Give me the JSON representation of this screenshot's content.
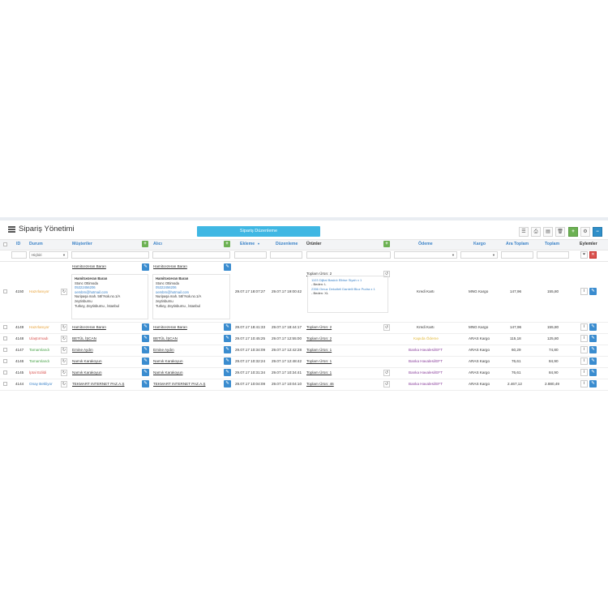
{
  "title": "Sipariş Yönetimi",
  "primary_button": "Sipariş Düzenleme",
  "columns": {
    "id": "ID",
    "status": "Durum",
    "customers": "Müşteriler",
    "buyer": "Alıcı",
    "added": "Ekleme",
    "edited": "Düzenleme",
    "products": "Ürünler",
    "payment": "Ödeme",
    "shipping": "Kargo",
    "subtotal": "Ara Toplam",
    "total": "Toplam",
    "actions": "Eylemler"
  },
  "filters": {
    "status_select": "Hiçbiri"
  },
  "expanded_row": {
    "id": "4150",
    "status": "Hazırlanıyor",
    "customer_link": "Hamitcezeran Baran",
    "customer_card": {
      "name": "Hamitcezeran Baran",
      "line1": "Stonc Ottimoda",
      "phone": "05322456206",
      "email": "oembrn@hotmail.com",
      "addr1": "Nuripaşa mah. 58/?sok.no.1/A",
      "addr2": "zeytinburnu",
      "addr3": "Turkey, Zeytinburnu , İstanbul"
    },
    "buyer_link": "Hamitcezeran Baran",
    "buyer_card": {
      "name": "Hamitcezeran Baran",
      "line1": "Stonc Ottimoda",
      "phone": "05322456206",
      "email": "oembrn@hotmail.com",
      "addr1": "Nuripaşa mah. 58/?sok.no.1/A",
      "addr2": "zeytinburnu",
      "addr3": "Turkey, Zeytinburnu , İstanbul"
    },
    "added": "29.07.17 18:07:27",
    "edited": "29.07.17 19:00:42",
    "products_link": "Toplam Ürün: 2",
    "product_items": [
      {
        "name": "1103 Dijital Baskılı Elbise Siyah x 1",
        "detail": "- Beden: L"
      },
      {
        "name": "2356 Omuz Dekolteli Dantelli Bluz Pudra x 1",
        "detail": "- Beden: XL"
      }
    ],
    "payment": "Kredi Kartı",
    "shipping": "MNG Kargo",
    "subtotal": "147,96",
    "total": "155,80"
  },
  "rows": [
    {
      "id": "4149",
      "status": "Hazırlanıyor",
      "customer": "Hamitcezeran Baran",
      "buyer": "Hamitcezeran Baran",
      "added": "29.07.17 18:41:33",
      "edited": "29.07.17 18:44:17",
      "products": "Toplam Ürün: 2",
      "payment": "Kredi Kartı",
      "shipping": "MNG Kargo",
      "subtotal": "147,96",
      "total": "155,80"
    },
    {
      "id": "4148",
      "status": "Ulaştırmadı",
      "customer": "BETÜL İŞCAN",
      "buyer": "BETÜL İŞCAN",
      "added": "29.07.17 10:45:25",
      "edited": "29.07.17 12:55:00",
      "products": "Toplam Ürün: 2",
      "payment": "Kapıda Ödeme",
      "shipping": "ARAS Kargo",
      "subtotal": "115,18",
      "total": "125,80"
    },
    {
      "id": "4147",
      "status": "Tamamlandı",
      "customer": "Emine Aydın",
      "buyer": "Emine Aydın",
      "added": "29.07.17 10:34:09",
      "edited": "29.07.17 12:42:28",
      "products": "Toplam Ürün: 1",
      "payment": "Banka Havalesi/EFT",
      "shipping": "ARAS Kargo",
      "subtotal": "60,29",
      "total": "74,80"
    },
    {
      "id": "4146",
      "status": "Tamamlandı",
      "customer": "Namık Karakoyun",
      "buyer": "Namık Karakoyun",
      "added": "29.07.17 10:32:24",
      "edited": "29.07.17 12:48:42",
      "products": "Toplam Ürün: 1",
      "payment": "Banka Havalesi/EFT",
      "shipping": "ARAS Kargo",
      "subtotal": "76,61",
      "total": "84,90"
    },
    {
      "id": "4145",
      "status": "İptal Edildi",
      "customer": "Namık Karakoyun",
      "buyer": "Namık Karakoyun",
      "added": "29.07.17 10:31:34",
      "edited": "29.07.17 10:34:41",
      "products": "Toplam Ürün: 1",
      "payment": "Banka Havalesi/EFT",
      "shipping": "ARAS Kargo",
      "subtotal": "76,61",
      "total": "84,90"
    },
    {
      "id": "4144",
      "status": "Onay Bekliyor",
      "customer": "TEKMART INTERNET PAZ.A.Ş",
      "buyer": "TEKMART INTERNET PAZ.A.Ş",
      "added": "29.07.17 10:04:09",
      "edited": "29.07.17 10:04:10",
      "products": "Toplam Ürün: 46",
      "payment": "Banka Havalesi/EFT",
      "shipping": "ARAS Kargo",
      "subtotal": "2.467,12",
      "total": "2.880,49"
    }
  ],
  "colors": {
    "primary_button": "#3fb7e3",
    "edit_button": "#3a8ccf",
    "add_green": "#6cb153",
    "header_link": "#3c83c8",
    "status_preparing": "#e8a33a",
    "status_failed": "#d9534f",
    "status_done": "#4aa34a",
    "status_pending": "#3c83c8",
    "payment_transfer": "#8a3f9c"
  }
}
